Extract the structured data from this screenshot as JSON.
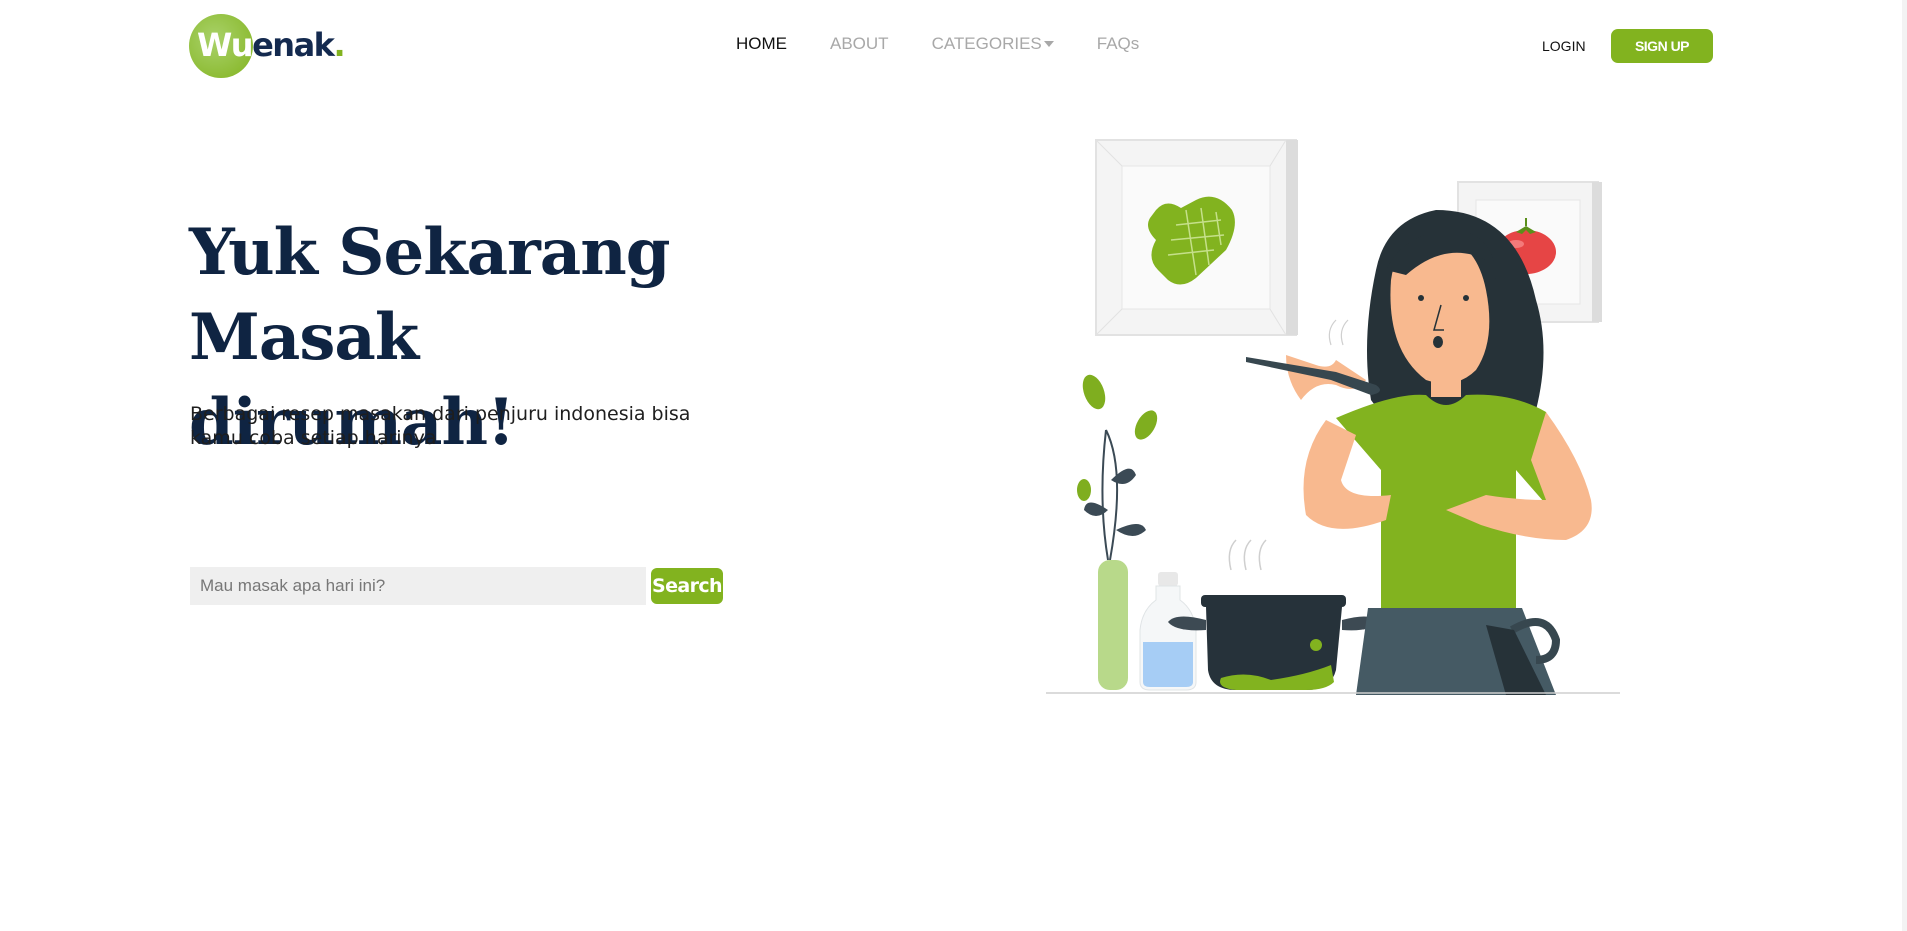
{
  "brand": {
    "logo_letters": "Wu",
    "logo_rest": "enak",
    "logo_dot": ".",
    "accent_color": "#82b31f",
    "dark_color": "#0f2442"
  },
  "nav": {
    "items": [
      {
        "label": "HOME",
        "active": true
      },
      {
        "label": "ABOUT",
        "active": false
      },
      {
        "label": "CATEGORIES",
        "active": false,
        "has_dropdown": true
      },
      {
        "label": "FAQs",
        "active": false
      }
    ],
    "login_label": "LOGIN",
    "signup_label": "SIGN UP"
  },
  "hero": {
    "title_line1": "Yuk Sekarang",
    "title_line2": "Masak dirumah!",
    "subtitle": "Berbagai resep masakan dari penjuru indonesia bisa kamu coba setiap harinya"
  },
  "search": {
    "placeholder": "Mau masak apa hari ini?",
    "value": "",
    "button_label": "Search"
  },
  "illustration": {
    "description_icon": "woman-cooking-illustration",
    "icons": [
      "oven-mitt-icon",
      "tomato-icon",
      "plant-vase-icon",
      "bottle-icon",
      "pot-icon"
    ]
  }
}
